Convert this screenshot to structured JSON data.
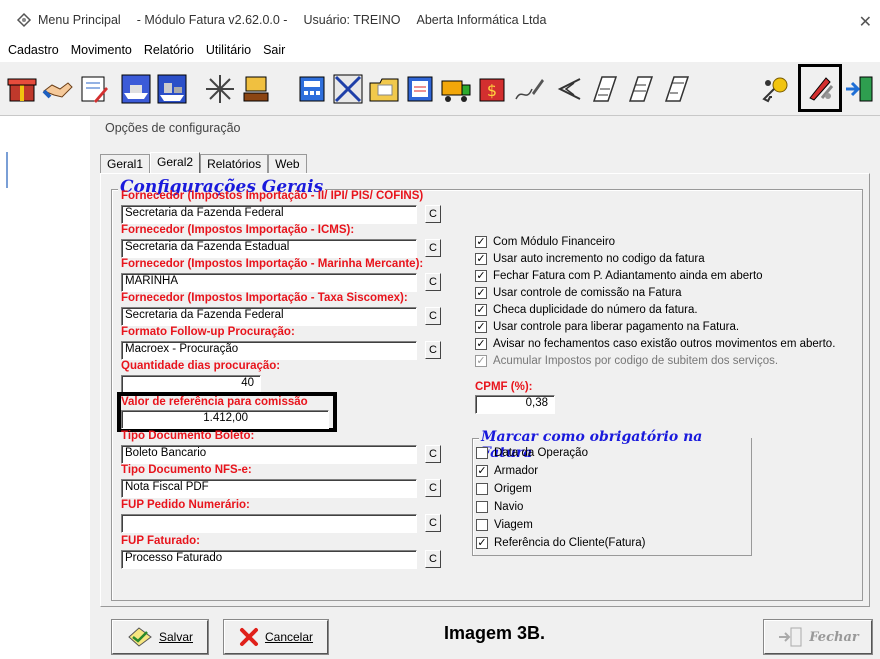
{
  "window": {
    "title_app": "Menu Principal",
    "title_module": "- Módulo Fatura v2.62.0.0 -",
    "title_user": "Usuário: TREINO",
    "title_company": "Aberta Informática Ltda",
    "close_symbol": "✕"
  },
  "menu": [
    "Cadastro",
    "Movimento",
    "Relatório",
    "Utilitário",
    "Sair"
  ],
  "toolbar_icons": [
    "gift-icon",
    "handshake-icon",
    "document-pen-icon",
    "ship-icon",
    "container-ship-icon",
    "sparkle-icon",
    "stamp-icon",
    "calculator-icon",
    "package-icon",
    "folder-icon",
    "report-icon",
    "truck-icon",
    "money-icon",
    "pen-signature-icon",
    "arrow-left-icon",
    "page-icon-1",
    "page-icon-2",
    "page-icon-3",
    "key-icon",
    "tools-icon",
    "exit-icon"
  ],
  "form": {
    "title": "Opções de configuração",
    "tabs": [
      "Geral1",
      "Geral2",
      "Relatórios",
      "Web"
    ],
    "active_tab": "Geral2",
    "group_title": "Configurações Gerais",
    "fields": [
      {
        "label": "Fornecedor (Impostos Importação - II/ IPI/ PIS/ COFINS)",
        "value": "Secretaria da Fazenda Federal"
      },
      {
        "label": "Fornecedor (Impostos Importação - ICMS):",
        "value": "Secretaria da Fazenda Estadual"
      },
      {
        "label": "Fornecedor (Impostos Importação - Marinha Mercante):",
        "value": "MARINHA"
      },
      {
        "label": "Fornecedor (Impostos Importação - Taxa Siscomex):",
        "value": "Secretaria da Fazenda Federal"
      },
      {
        "label": "Formato Follow-up Procuração:",
        "value": "Macroex - Procuração"
      },
      {
        "label": "Quantidade dias procuração:",
        "value": "40"
      },
      {
        "label": "Valor de referência para comissão",
        "value": "1.412,00"
      },
      {
        "label": "Tipo Documento Boleto:",
        "value": "Boleto Bancario"
      },
      {
        "label": "Tipo Documento NFS-e:",
        "value": "Nota Fiscal PDF"
      },
      {
        "label": "FUP Pedido Numerário:",
        "value": ""
      },
      {
        "label": "FUP Faturado:",
        "value": "Processo Faturado"
      }
    ],
    "c_label": "C",
    "checkboxes": [
      {
        "label": "Com Módulo Financeiro",
        "checked": true
      },
      {
        "label": "Usar auto incremento no codigo da fatura",
        "checked": true
      },
      {
        "label": "Fechar Fatura com P. Adiantamento ainda em aberto",
        "checked": true
      },
      {
        "label": "Usar controle de comissão na Fatura",
        "checked": true
      },
      {
        "label": "Checa duplicidade do número da fatura.",
        "checked": true
      },
      {
        "label": "Usar controle para liberar pagamento na Fatura.",
        "checked": true
      },
      {
        "label": "Avisar no fechamentos caso existão outros movimentos em aberto.",
        "checked": true
      },
      {
        "label": "Acumular Impostos por codigo de subitem dos  serviços.",
        "checked": true,
        "disabled": true
      }
    ],
    "cpmf": {
      "label": "CPMF (%):",
      "value": "0,38"
    },
    "mandatory_group": {
      "title": "Marcar como obrigatório na Fatura",
      "items": [
        {
          "label": "Data da Operação",
          "checked": false
        },
        {
          "label": "Armador",
          "checked": true
        },
        {
          "label": "Origem",
          "checked": false
        },
        {
          "label": "Navio",
          "checked": false
        },
        {
          "label": "Viagem",
          "checked": false
        },
        {
          "label": "Referência do Cliente(Fatura)",
          "checked": true
        }
      ]
    }
  },
  "buttons": {
    "save": "Salvar",
    "cancel": "Cancelar",
    "close": "Fechar"
  },
  "caption": "Imagem 3B."
}
